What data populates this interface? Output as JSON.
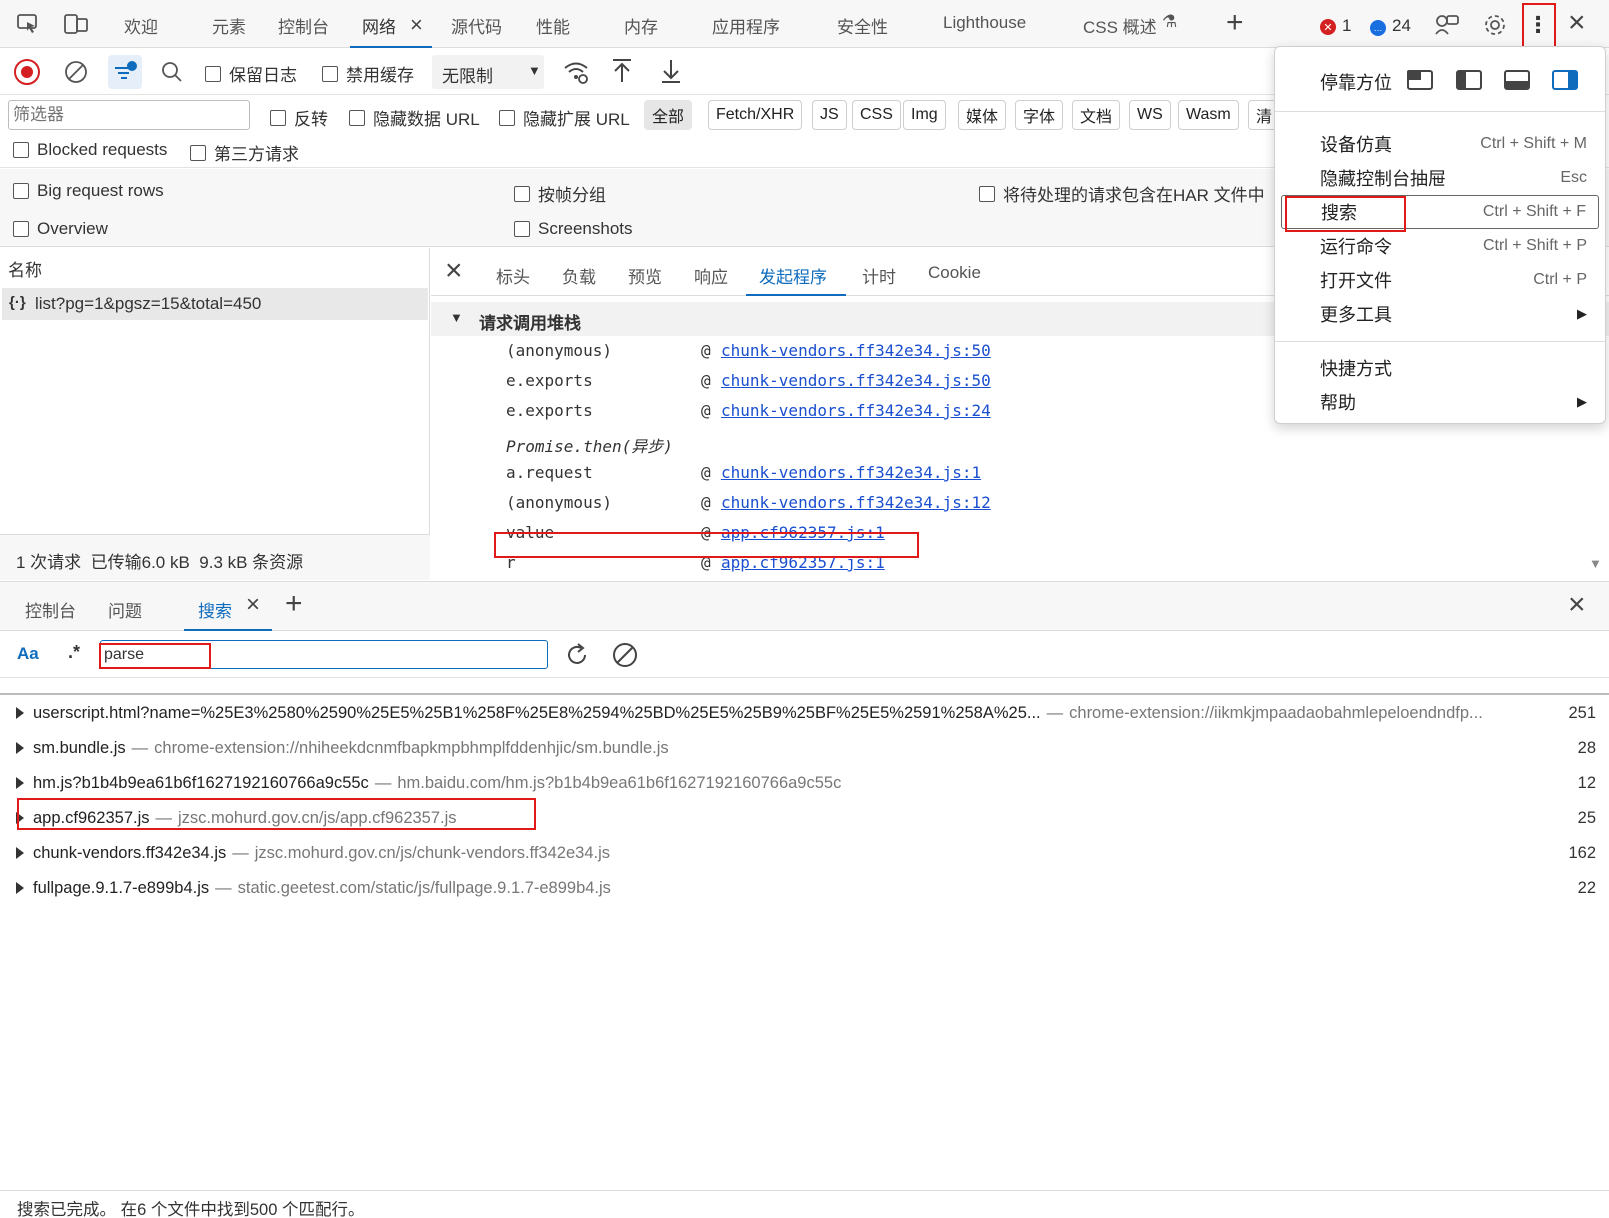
{
  "top_tabs": [
    "欢迎",
    "元素",
    "控制台",
    "网络",
    "源代码",
    "性能",
    "内存",
    "应用程序",
    "安全性",
    "Lighthouse",
    "CSS 概述"
  ],
  "top_right": {
    "errors": "1",
    "messages": "24"
  },
  "toolbar": {
    "preserve_log": "保留日志",
    "disable_cache": "禁用缓存",
    "throttle": "无限制"
  },
  "filter_row": {
    "placeholder": "筛选器",
    "invert": "反转",
    "hide_data_url": "隐藏数据 URL",
    "hide_ext_url": "隐藏扩展 URL",
    "types": [
      "全部",
      "Fetch/XHR",
      "JS",
      "CSS",
      "Img",
      "媒体",
      "字体",
      "文档",
      "WS",
      "Wasm",
      "清"
    ]
  },
  "options": {
    "blocked": "Blocked requests",
    "third_party": "第三方请求",
    "big_rows": "Big request rows",
    "group_by_frame": "按帧分组",
    "har": "将待处理的请求包含在HAR 文件中",
    "overview": "Overview",
    "screenshots": "Screenshots"
  },
  "request_list": {
    "header": "名称",
    "items": [
      "list?pg=1&pgsz=15&total=450"
    ],
    "summary": "1 次请求  已传输6.0 kB  9.3 kB 条资源"
  },
  "detail_tabs": [
    "标头",
    "负载",
    "预览",
    "响应",
    "发起程序",
    "计时",
    "Cookie"
  ],
  "stack": {
    "title": "请求调用堆栈",
    "frames": [
      {
        "fn": "(anonymous)",
        "at": "@",
        "loc": "chunk-vendors.ff342e34.js:50"
      },
      {
        "fn": "e.exports",
        "at": "@",
        "loc": "chunk-vendors.ff342e34.js:50"
      },
      {
        "fn": "e.exports",
        "at": "@",
        "loc": "chunk-vendors.ff342e34.js:24"
      },
      {
        "fn": "Promise.then(异步)",
        "at": "",
        "loc": ""
      },
      {
        "fn": "a.request",
        "at": "@",
        "loc": "chunk-vendors.ff342e34.js:1"
      },
      {
        "fn": "(anonymous)",
        "at": "@",
        "loc": "chunk-vendors.ff342e34.js:12"
      },
      {
        "fn": "value",
        "at": "@",
        "loc": "app.cf962357.js:1"
      },
      {
        "fn": "r",
        "at": "@",
        "loc": "app.cf962357.js:1"
      }
    ]
  },
  "menu": {
    "dock_label": "停靠方位",
    "items": [
      {
        "label": "设备仿真",
        "shortcut": "Ctrl + Shift + M"
      },
      {
        "label": "隐藏控制台抽屉",
        "shortcut": "Esc"
      },
      {
        "label": "搜索",
        "shortcut": "Ctrl + Shift + F"
      },
      {
        "label": "运行命令",
        "shortcut": "Ctrl + Shift + P"
      },
      {
        "label": "打开文件",
        "shortcut": "Ctrl + P"
      },
      {
        "label": "更多工具",
        "shortcut": ""
      },
      {
        "label": "快捷方式",
        "shortcut": ""
      },
      {
        "label": "帮助",
        "shortcut": ""
      }
    ]
  },
  "drawer": {
    "tabs": [
      "控制台",
      "问题",
      "搜索"
    ],
    "case_btn": "Aa",
    "regex_btn": ".*",
    "query": "parse",
    "results": [
      {
        "name": "userscript.html?name=%25E3%2580%2590%25E5%25B1%258F%25E8%2594%25BD%25E5%25B9%25BF%25E5%2591%258A%25...",
        "url": "chrome-extension://iikmkjmpaadaobahmlepeloendndfp...",
        "count": "251"
      },
      {
        "name": "sm.bundle.js",
        "url": "chrome-extension://nhiheekdcnmfbapkmpbhmplfddenhjic/sm.bundle.js",
        "count": "28"
      },
      {
        "name": "hm.js?b1b4b9ea61b6f1627192160766a9c55c",
        "url": "hm.baidu.com/hm.js?b1b4b9ea61b6f1627192160766a9c55c",
        "count": "12"
      },
      {
        "name": "app.cf962357.js",
        "url": "jzsc.mohurd.gov.cn/js/app.cf962357.js",
        "count": "25"
      },
      {
        "name": "chunk-vendors.ff342e34.js",
        "url": "jzsc.mohurd.gov.cn/js/chunk-vendors.ff342e34.js",
        "count": "162"
      },
      {
        "name": "fullpage.9.1.7-e899b4.js",
        "url": "static.geetest.com/static/js/fullpage.9.1.7-e899b4.js",
        "count": "22"
      }
    ],
    "status": "搜索已完成。 在6 个文件中找到500 个匹配行。"
  },
  "colors": {
    "accent": "#0f6cbd",
    "highlight": "#e01919"
  }
}
